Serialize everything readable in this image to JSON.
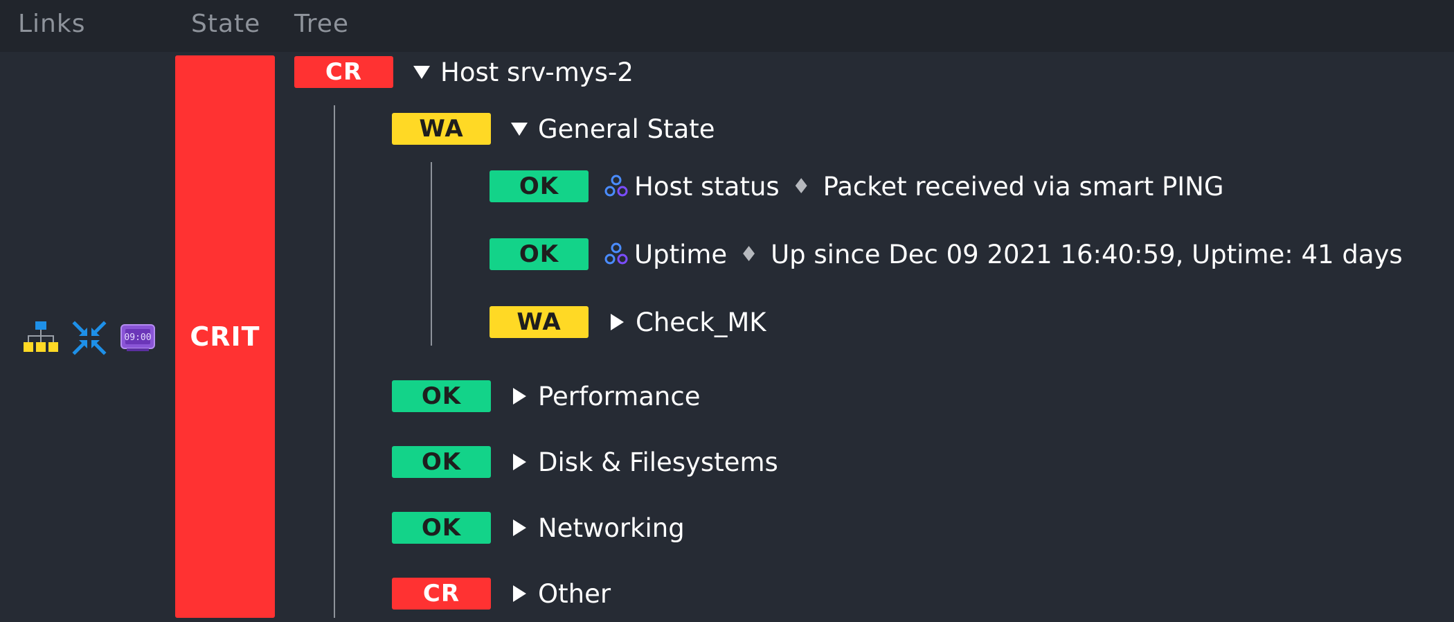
{
  "columns": {
    "links": "Links",
    "state": "State",
    "tree": "Tree"
  },
  "links": {
    "icons": [
      "aggregation-tree-icon",
      "collapse-icon",
      "downtime-clock-icon"
    ],
    "clock_text": "09:00"
  },
  "state": {
    "label": "CRIT",
    "color": "#ff3232"
  },
  "tree": {
    "root": {
      "state": "CR",
      "label": "Host srv-mys-2",
      "expanded": true
    },
    "general_state": {
      "state": "WA",
      "label": "General State",
      "expanded": true
    },
    "host_status": {
      "state": "OK",
      "label": "Host status",
      "separator": "♦",
      "output": "Packet received via smart PING"
    },
    "uptime": {
      "state": "OK",
      "label": "Uptime",
      "separator": "♦",
      "output": "Up since Dec 09 2021 16:40:59, Uptime: 41 days"
    },
    "check_mk": {
      "state": "WA",
      "label": "Check_MK",
      "expanded": false
    },
    "performance": {
      "state": "OK",
      "label": "Performance",
      "expanded": false
    },
    "disk": {
      "state": "OK",
      "label": "Disk & Filesystems",
      "expanded": false
    },
    "networking": {
      "state": "OK",
      "label": "Networking",
      "expanded": false
    },
    "other": {
      "state": "CR",
      "label": "Other",
      "expanded": false
    }
  },
  "colors": {
    "background": "#262b34",
    "header": "#21252c",
    "crit": "#ff3232",
    "warn": "#ffd925",
    "ok": "#13d389"
  }
}
